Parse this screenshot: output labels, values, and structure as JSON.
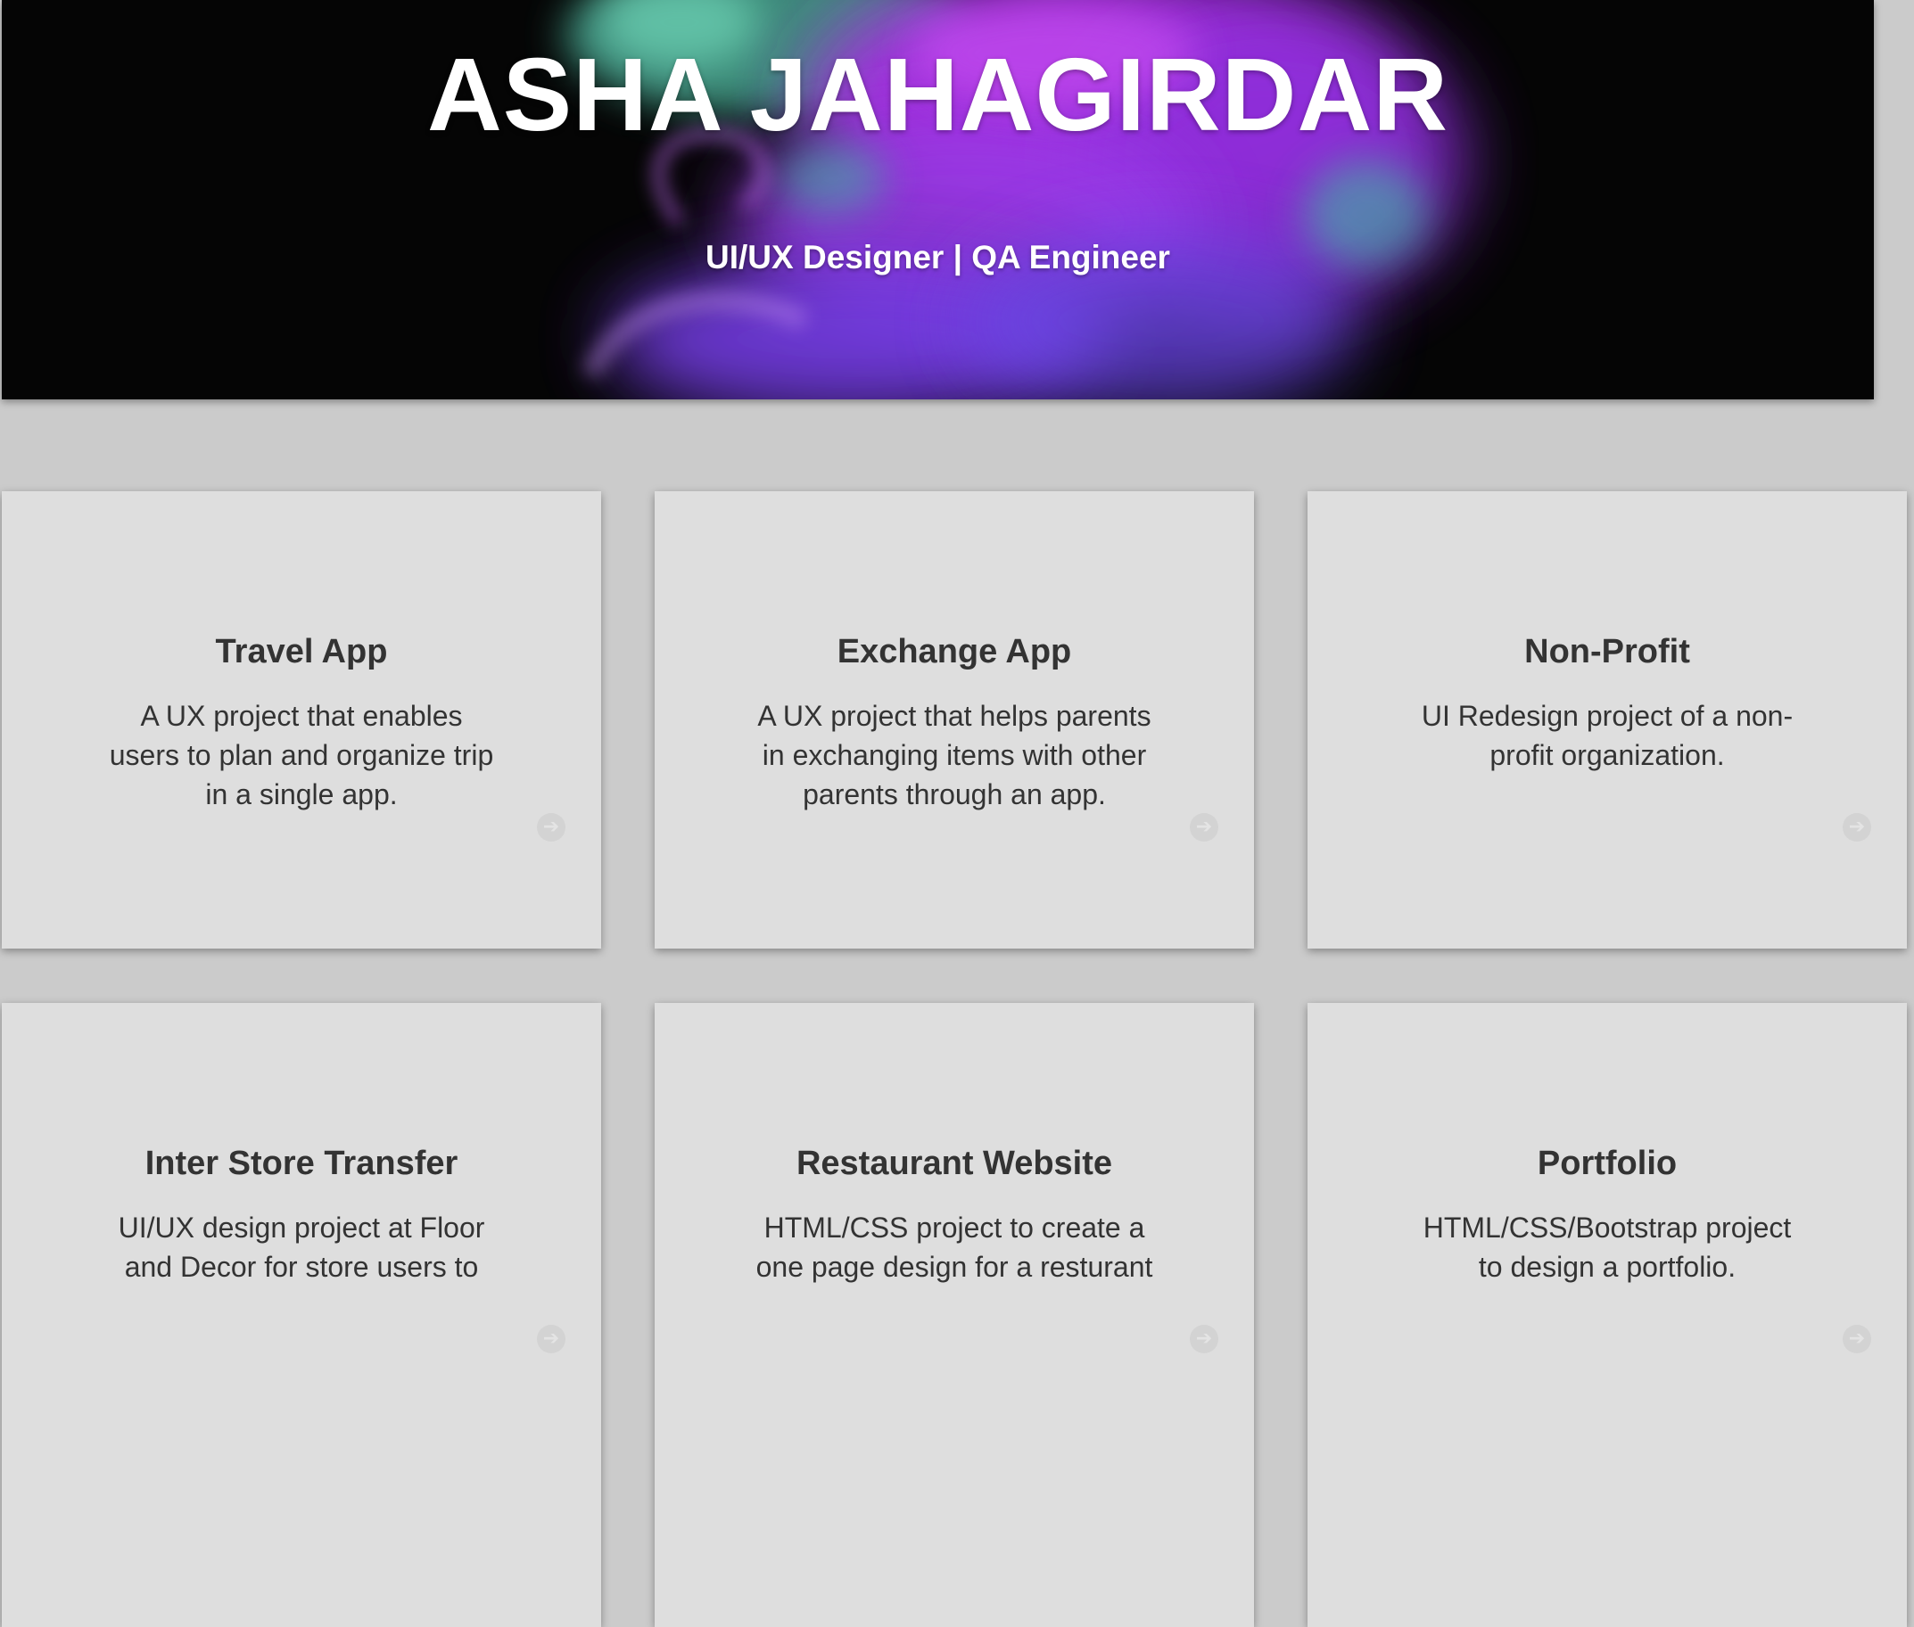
{
  "hero": {
    "title": "ASHA JAHAGIRDAR",
    "subtitle": "UI/UX Designer | QA Engineer",
    "background_colors": [
      "#050505",
      "#a52fe0",
      "#7a3ff0",
      "#3fb8a6",
      "#6fd6b8"
    ]
  },
  "colors": {
    "page_background": "#cbcbcb",
    "card_background": "#dedede",
    "card_text": "#333333",
    "hero_text": "#ffffff"
  },
  "projects": [
    {
      "title": "Travel App",
      "description": "A UX project that enables users to plan and organize trip in a single app.",
      "icon": "arrow-right-circle-icon"
    },
    {
      "title": "Exchange App",
      "description": "A UX project that helps parents in exchanging items with other parents through an app.",
      "icon": "arrow-right-circle-icon"
    },
    {
      "title": "Non-Profit",
      "description": "UI Redesign project of a non-profit organization.",
      "icon": "arrow-right-circle-icon"
    },
    {
      "title": "Inter Store Transfer",
      "description": "UI/UX design project at Floor and Decor for store users to",
      "icon": "arrow-right-circle-icon"
    },
    {
      "title": "Restaurant Website",
      "description": "HTML/CSS project to create a one page design for a resturant",
      "icon": "arrow-right-circle-icon"
    },
    {
      "title": "Portfolio",
      "description": "HTML/CSS/Bootstrap project to design a portfolio.",
      "icon": "arrow-right-circle-icon"
    }
  ]
}
